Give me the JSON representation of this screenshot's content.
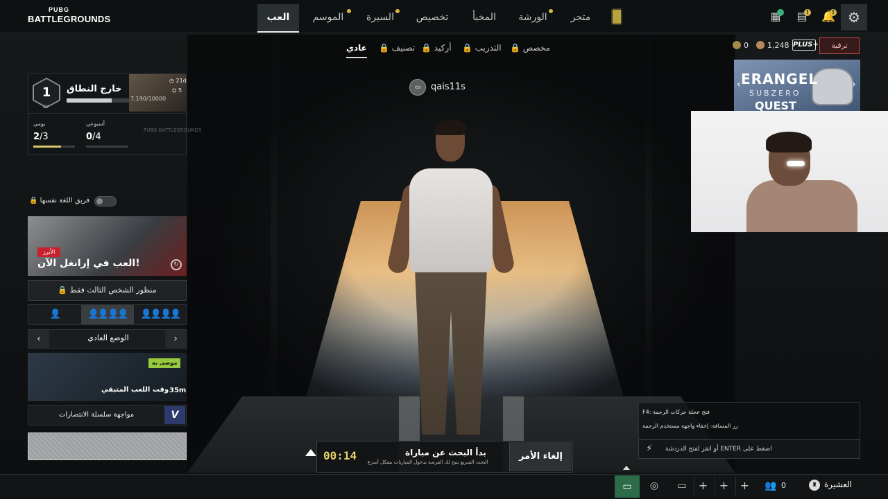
{
  "logo": {
    "small": "PUBG",
    "big": "BATTLEGROUNDS"
  },
  "nav": {
    "tabs": [
      {
        "id": "play",
        "label": "العب",
        "active": true
      },
      {
        "id": "season",
        "label": "الموسم"
      },
      {
        "id": "career",
        "label": "السيرة"
      },
      {
        "id": "customize",
        "label": "تخصيص"
      },
      {
        "id": "stash",
        "label": "المخبأ"
      },
      {
        "id": "workshop",
        "label": "الورشة"
      },
      {
        "id": "store",
        "label": "متجر"
      }
    ]
  },
  "modes": {
    "tabs": [
      {
        "label": "عادي",
        "active": true
      },
      {
        "label": "تصنيف"
      },
      {
        "label": "أركيد"
      },
      {
        "label": "التدريب"
      },
      {
        "label": "مخصص"
      }
    ]
  },
  "currency": {
    "coin": "0",
    "bp": "1,248",
    "plus": "PLUS+",
    "upgrade": "ترقية"
  },
  "event_banner": {
    "line1": "ERANGEL",
    "line2": "SUBZERO",
    "line3": "QUEST"
  },
  "player": {
    "name": "qais11s",
    "level": "1",
    "lv": "LV",
    "rank_title": "خارج النطاق",
    "xp_text": "7,190/10000",
    "xp_fraction": 0.72,
    "season_days": "21d",
    "season_count": "5"
  },
  "missions": {
    "daily_label": "يومي",
    "daily_value": "2",
    "daily_total": "/3",
    "daily_fraction": 0.67,
    "weekly_label": "أسبوعي",
    "weekly_value": "0",
    "weekly_total": "/4",
    "weekly_fraction": 0,
    "watermark": "PUBG BATTLEGROUNDS"
  },
  "team_toggle": {
    "label": "فريق اللغة نفسها",
    "on": false
  },
  "promo": {
    "tag": "الأبرز",
    "title": "العب في إرانغل الآن!"
  },
  "perspective": {
    "label": "منظور الشخص الثالث فقط"
  },
  "squad": {
    "options": [
      "👤",
      "👤👤👤👤",
      "👤👤👤👤"
    ],
    "selected": 1
  },
  "mode_select": {
    "name": "الوضع العادي"
  },
  "playtime": {
    "badge": "موصى به",
    "title": "وقت اللعب المتبقي",
    "time": "35m"
  },
  "streak": {
    "label": "مواجهة سلسلة الانتصارات",
    "icon": "V"
  },
  "match": {
    "timer": "00:14",
    "title": "بدأ البحث عن مباراة",
    "subtitle": "البحث السريع يتيح لك الفرصة بدخول المباريات بشكل أسرع",
    "cancel": "إلغاء الأمر"
  },
  "chat": {
    "line1": "F4: فتح عجلة حركات الرحمة",
    "line2": "زر المسافة: إخفاء واجهة مستخدم الرحمة",
    "input_placeholder": "أو انقر لفتح الدردشة ENTER اضغط على"
  },
  "bottom": {
    "party_count": "0",
    "clan": "العشيرة"
  },
  "colors": {
    "accent": "#d9b84a",
    "danger": "#b64b4b",
    "chat_active": "#2d6c4a"
  }
}
